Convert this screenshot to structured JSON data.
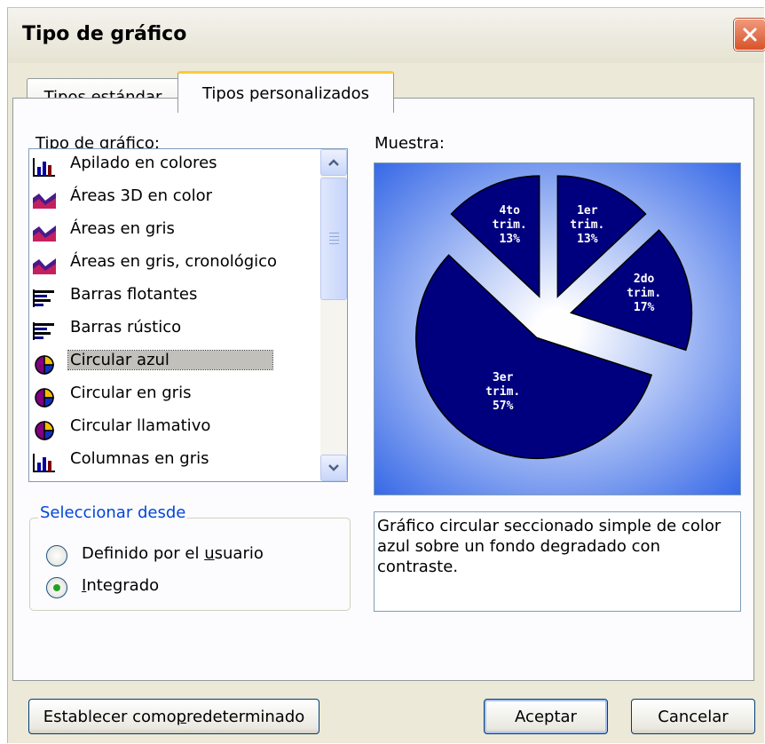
{
  "dialog": {
    "title": "Tipo de gráfico"
  },
  "tabs": [
    {
      "label": "Tipos estándar"
    },
    {
      "label": "Tipos personalizados"
    }
  ],
  "chart_type_label": "Tipo de gráfico:",
  "chart_types": [
    {
      "label": "Apilado en colores",
      "icon": "column-chart-icon"
    },
    {
      "label": "Áreas 3D en color",
      "icon": "area-chart-icon"
    },
    {
      "label": "Áreas en gris",
      "icon": "area-chart-icon"
    },
    {
      "label": "Áreas en gris, cronológico",
      "icon": "area-chart-icon"
    },
    {
      "label": "Barras flotantes",
      "icon": "bar-chart-icon"
    },
    {
      "label": "Barras rústico",
      "icon": "bar-chart-icon"
    },
    {
      "label": "Circular azul",
      "icon": "pie-chart-icon",
      "selected": true
    },
    {
      "label": "Circular en gris",
      "icon": "pie-chart-icon"
    },
    {
      "label": "Circular llamativo",
      "icon": "pie-chart-icon"
    },
    {
      "label": "Columnas en gris",
      "icon": "column-chart-icon"
    }
  ],
  "select_from": {
    "title": "Seleccionar desde",
    "options": [
      {
        "label_pre": "Definido por el ",
        "label_key": "u",
        "label_post": "suario",
        "checked": false
      },
      {
        "label_pre": "",
        "label_key": "I",
        "label_post": "ntegrado",
        "checked": true
      }
    ]
  },
  "sample_label": "Muestra:",
  "chart_data": {
    "type": "pie",
    "slices": [
      {
        "l1": "1er",
        "l2": "trim.",
        "l3": "13%",
        "value": 13
      },
      {
        "l1": "2do",
        "l2": "trim.",
        "l3": "17%",
        "value": 17
      },
      {
        "l1": "3er",
        "l2": "trim.",
        "l3": "57%",
        "value": 57
      },
      {
        "l1": "4to",
        "l2": "trim.",
        "l3": "13%",
        "value": 13
      }
    ],
    "exploded": true,
    "slice_color": "#00007f",
    "background": "radial gradient white center to blue edge"
  },
  "description": "Gráfico circular seccionado simple de color azul sobre un fondo degradado con contraste.",
  "buttons": {
    "set_default_pre": "Establecer como ",
    "set_default_key": "p",
    "set_default_post": "redeterminado",
    "ok": "Aceptar",
    "cancel": "Cancelar"
  },
  "colors": {
    "dialog_bg": "#ece9d8",
    "slice": "#00007f",
    "preview_edge": "#2a5fe5",
    "group_title": "#0046d5"
  }
}
